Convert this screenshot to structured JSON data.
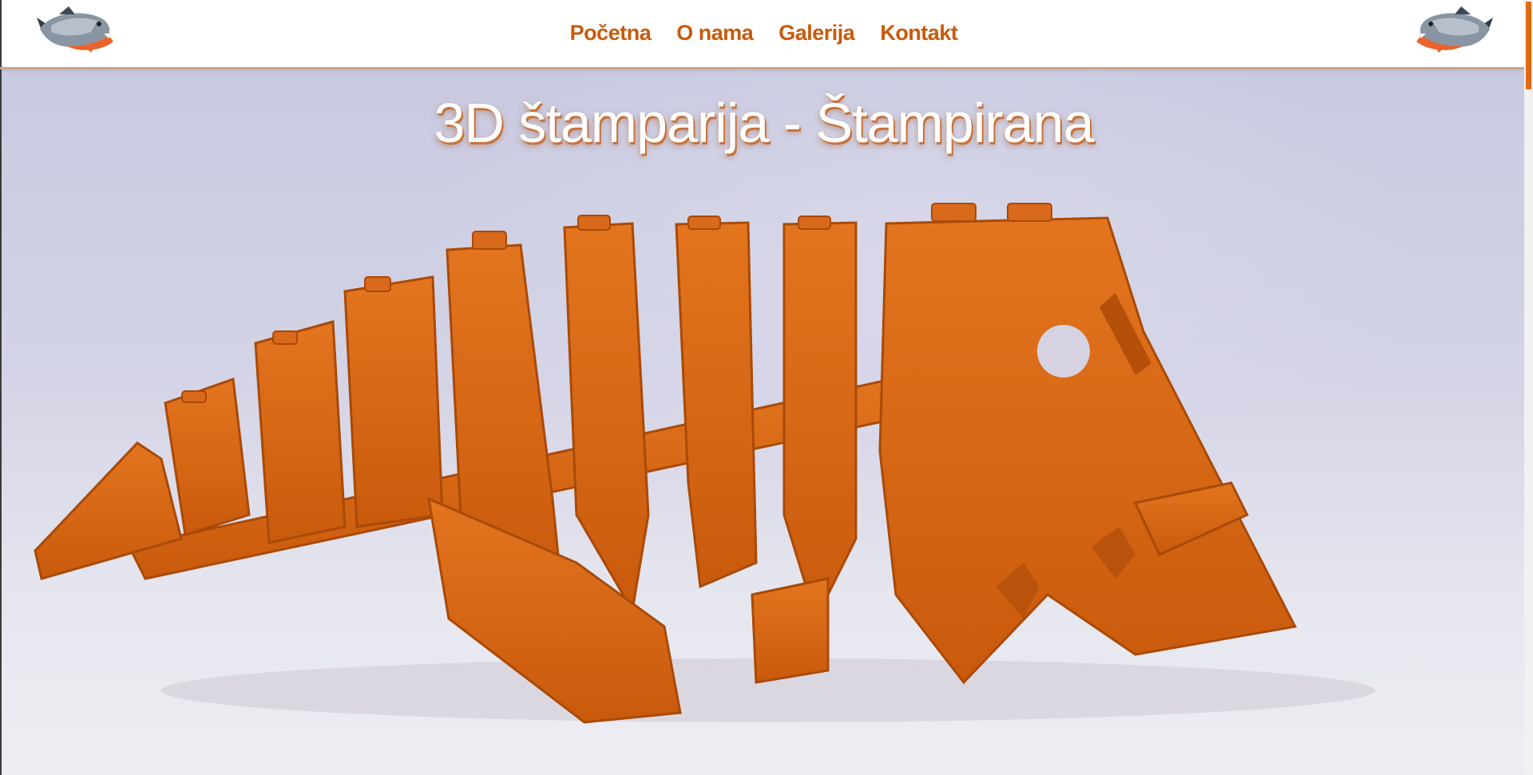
{
  "nav": {
    "items": [
      "Početna",
      "O nama",
      "Galerija",
      "Kontakt"
    ]
  },
  "logo": {
    "left_icon": "piranha-logo-icon",
    "right_icon": "piranha-logo-icon"
  },
  "hero": {
    "title": "3D štamparija - Štampirana"
  },
  "colors": {
    "accent": "#c85a0c",
    "model": "#e06a12",
    "background": "#d4d4e6"
  }
}
